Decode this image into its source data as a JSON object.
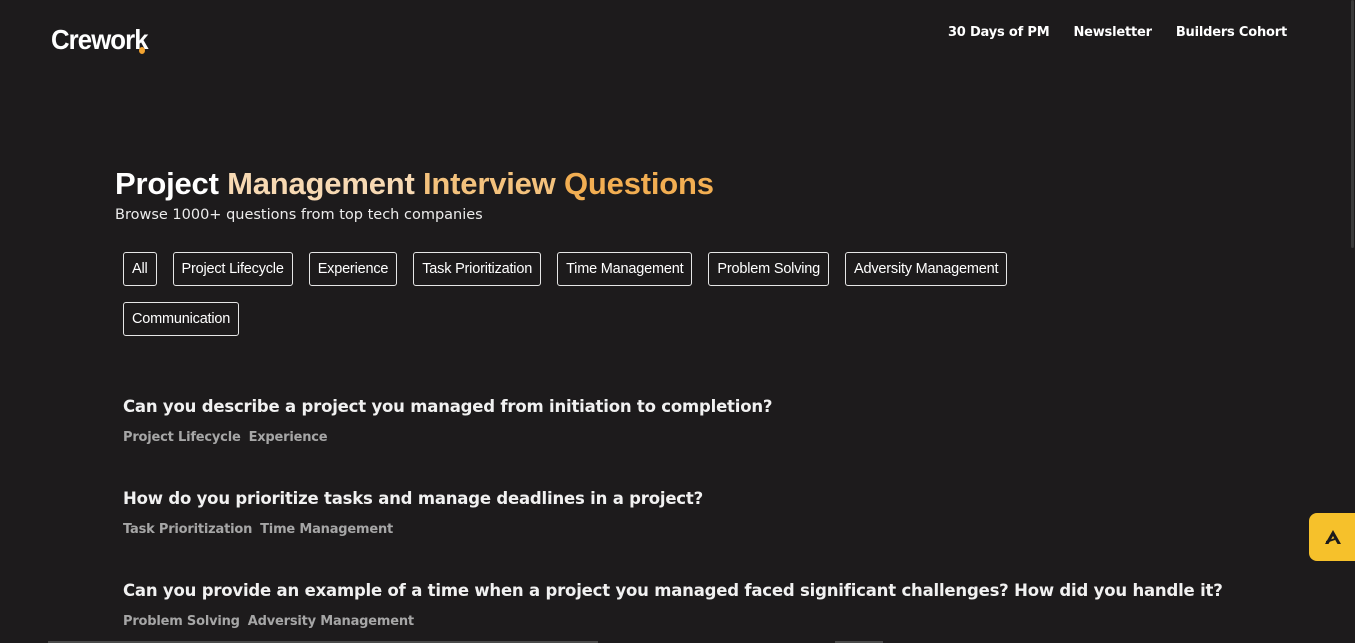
{
  "header": {
    "logo_text": "Crework",
    "nav": [
      {
        "label": "30 Days of PM"
      },
      {
        "label": "Newsletter"
      },
      {
        "label": "Builders Cohort"
      }
    ]
  },
  "hero": {
    "title_parts": [
      "Project ",
      "Management ",
      "Interview ",
      "Questions"
    ],
    "subtitle": "Browse 1000+ questions from top tech companies"
  },
  "filters": [
    {
      "label": "All"
    },
    {
      "label": "Project Lifecycle"
    },
    {
      "label": "Experience"
    },
    {
      "label": "Task Prioritization"
    },
    {
      "label": "Time Management"
    },
    {
      "label": "Problem Solving"
    },
    {
      "label": "Adversity Management"
    },
    {
      "label": "Communication"
    }
  ],
  "questions": [
    {
      "title": "Can you describe a project you managed from initiation to completion?",
      "tags": [
        "Project Lifecycle",
        "Experience"
      ]
    },
    {
      "title": "How do you prioritize tasks and manage deadlines in a project?",
      "tags": [
        "Task Prioritization",
        "Time Management"
      ]
    },
    {
      "title": "Can you provide an example of a time when a project you managed faced significant challenges? How did you handle it?",
      "tags": [
        "Problem Solving",
        "Adversity Management"
      ]
    }
  ],
  "floating_button": {
    "icon": "crework-logo-icon",
    "color": "#f6c12b"
  },
  "colors": {
    "background": "#1d1b1c",
    "accent": "#f2ae52",
    "logo_dot": "#f2a330"
  }
}
